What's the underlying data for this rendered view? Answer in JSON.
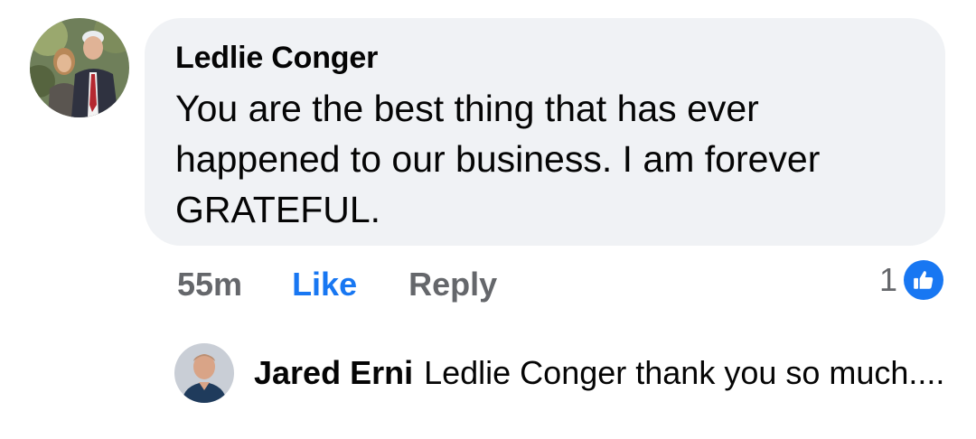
{
  "comment": {
    "author": "Ledlie Conger",
    "text": "You are the best thing that has ever happened to our business. I am forever GRATEFUL.",
    "time": "55m",
    "like_label": "Like",
    "reply_label": "Reply",
    "reaction_count": "1",
    "reaction_icon": "like-thumbs-up-icon",
    "avatar_icon": "profile-photo"
  },
  "reply": {
    "author": "Jared Erni",
    "text": "Ledlie Conger thank you so much....",
    "avatar_icon": "profile-photo"
  },
  "colors": {
    "accent": "#1877f2",
    "bubble": "#f0f2f5",
    "muted": "#65676b",
    "text": "#050505"
  }
}
